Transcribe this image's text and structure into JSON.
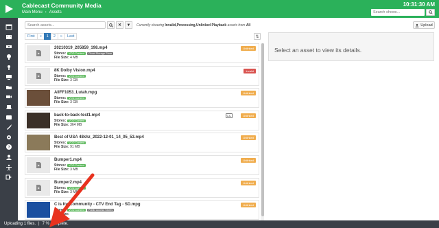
{
  "header": {
    "app_title": "Cablecast Community Media",
    "breadcrumb": [
      "Main Menu",
      "Assets"
    ],
    "clock": "10:31:30 AM",
    "search_placeholder": "Search shows..."
  },
  "sidebar": {
    "icons": [
      "calendar-icon",
      "film-icon",
      "stream-icon",
      "bulb-icon",
      "podcast-icon",
      "monitor-icon",
      "folder-icon",
      "video-icon",
      "laptop-icon",
      "cc-icon",
      "wrench-icon",
      "gear-icon",
      "help-icon",
      "user-icon",
      "accessibility-icon",
      "logout-icon"
    ]
  },
  "toolbar": {
    "search_placeholder": "Search assets...",
    "search_btn": "🔍",
    "clear_btn": "✕",
    "filter_btn": "▼",
    "filter_prefix": "Currently showing",
    "filter_values": "Invalid,Processing,Unlinked Playback",
    "filter_middle": "assets from",
    "filter_scope": "All",
    "upload_label": "Upload"
  },
  "pagination": {
    "items": [
      "First",
      "«",
      "1",
      "2",
      "»",
      "Last"
    ],
    "active": "1"
  },
  "details": {
    "placeholder": "Select an asset to view its details."
  },
  "labels": {
    "stores": "Stores:",
    "file_size": "File Size:"
  },
  "assets": [
    {
      "title": "20210319_205859_198.mp4",
      "stores": [
        "VOD Content",
        "Cloud Storage Store"
      ],
      "size": "4 MB",
      "status": "Unlinked",
      "thumb": "file"
    },
    {
      "title": "8K Dolby Vision.mp4",
      "stores": [
        "VOD Content"
      ],
      "size": "3 GB",
      "status": "Invalid",
      "thumb": "file"
    },
    {
      "title": "AIIFF1053_Lutah.mpg",
      "stores": [
        "VOD Content"
      ],
      "size": "3 GB",
      "status": "Unlinked",
      "thumb": "image"
    },
    {
      "title": "back-to-back-test1.mp4",
      "stores": [
        "VOD Content"
      ],
      "size": "364 MB",
      "status": "Unlinked",
      "thumb": "image",
      "cc": "CC"
    },
    {
      "title": "Best of USA 48khz_2022-12-01_14_05_53.mp4",
      "stores": [
        "VOD Content"
      ],
      "size": "91 MB",
      "status": "Unlinked",
      "thumb": "image"
    },
    {
      "title": "Bumper1.mp4",
      "stores": [
        "VOD Content"
      ],
      "size": "3 MB",
      "status": "Unlinked",
      "thumb": "file"
    },
    {
      "title": "Bumper2.mp4",
      "stores": [
        "VOD Content"
      ],
      "size": "3 MB",
      "status": "Unlinked",
      "thumb": "file"
    },
    {
      "title": "C is for Community - CTV End Tag - SD.mpg",
      "stores": [
        "VOD Content",
        "Public Access Stores"
      ],
      "size": "",
      "status": "Unlinked",
      "thumb": "image"
    }
  ],
  "statusbar": {
    "text": "Uploading 1 files.",
    "sep": "|",
    "progress": "7 % complete."
  }
}
